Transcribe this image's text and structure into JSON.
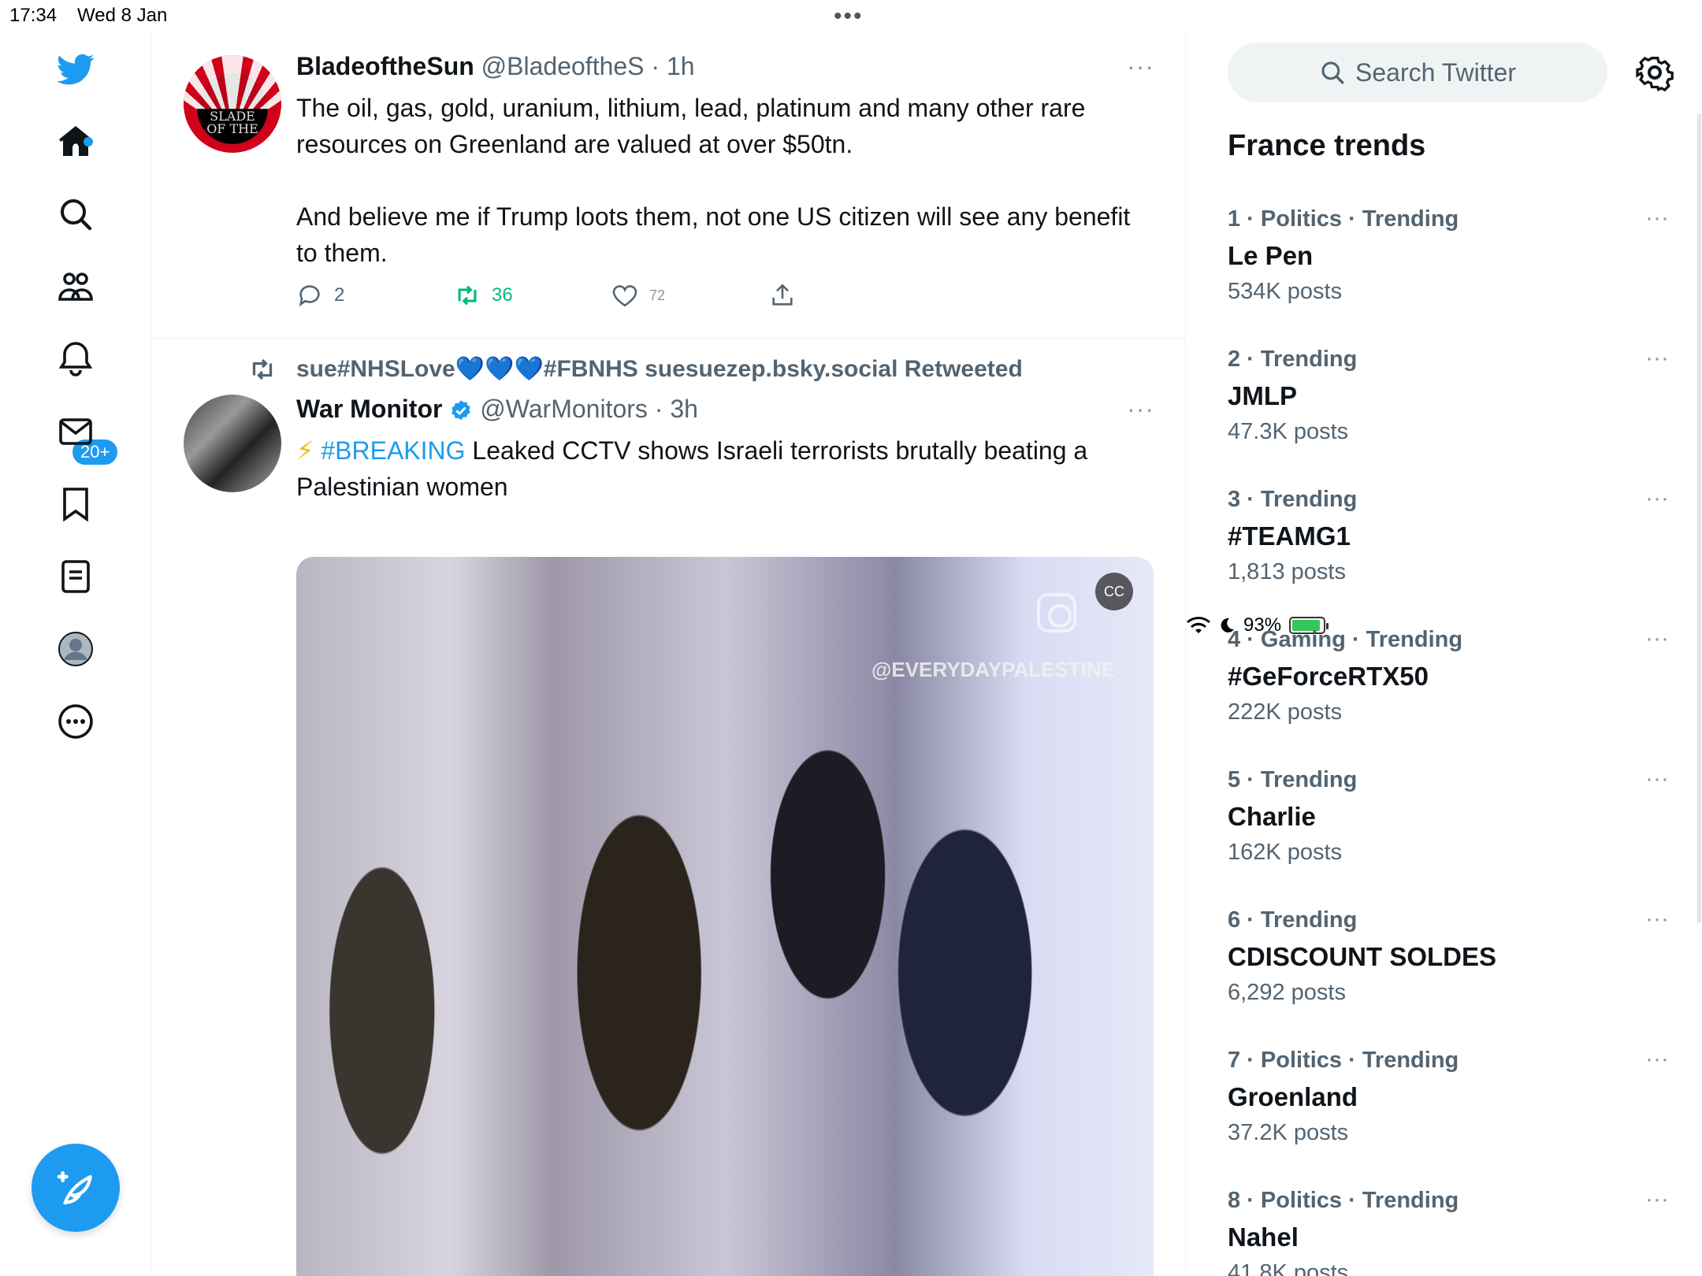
{
  "status": {
    "time": "17:34",
    "date": "Wed 8 Jan",
    "battery": "93%",
    "battery_level": 0.93
  },
  "nav": {
    "icons": [
      "twitter-logo",
      "home-icon",
      "search-icon",
      "communities-icon",
      "notifications-icon",
      "messages-icon",
      "bookmarks-icon",
      "lists-icon",
      "profile-icon",
      "more-icon"
    ],
    "notifications_badge": "20+",
    "accent": "#1d9bf0"
  },
  "tweets": [
    {
      "name": "BladeoftheSun",
      "handle": "@BladeoftheS",
      "time": "· 1h",
      "avatar_text": "SLADE OF THE",
      "text": "The oil, gas, gold, uranium, lithium, lead, platinum and many other rare resources on Greenland are valued at over $50tn.\n\nAnd believe me if Trump loots them, not one US citizen will see any benefit to them.",
      "replies": "2",
      "retweets": "36",
      "likes": "72"
    },
    {
      "retweeted_by": "sue#NHSLove💙💙💙#FBNHS suesuezep.bsky.social Retweeted",
      "name": "War Monitor",
      "handle": "@WarMonitors",
      "time": "· 3h",
      "text_emoji": "⚡",
      "text_hashtag": "#BREAKING",
      "text_rest": " Leaked CCTV shows Israeli terrorists brutally beating a Palestinian women",
      "media_watermark": "@EVERYDAYPALESTINE"
    }
  ],
  "sidebar": {
    "search_placeholder": "Search Twitter",
    "title": "France trends",
    "trends": [
      {
        "meta": "1 · Politics · Trending",
        "name": "Le Pen",
        "posts": "534K posts"
      },
      {
        "meta": "2 · Trending",
        "name": "JMLP",
        "posts": "47.3K posts"
      },
      {
        "meta": "3 · Trending",
        "name": "#TEAMG1",
        "posts": "1,813 posts"
      },
      {
        "meta": "4 · Gaming · Trending",
        "name": "#GeForceRTX50",
        "posts": "222K posts"
      },
      {
        "meta": "5 · Trending",
        "name": "Charlie",
        "posts": "162K posts"
      },
      {
        "meta": "6 · Trending",
        "name": "CDISCOUNT SOLDES",
        "posts": "6,292 posts"
      },
      {
        "meta": "7 · Politics · Trending",
        "name": "Groenland",
        "posts": "37.2K posts"
      },
      {
        "meta": "8 · Politics · Trending",
        "name": "Nahel",
        "posts": "41.8K posts"
      }
    ],
    "more_label": "···"
  }
}
